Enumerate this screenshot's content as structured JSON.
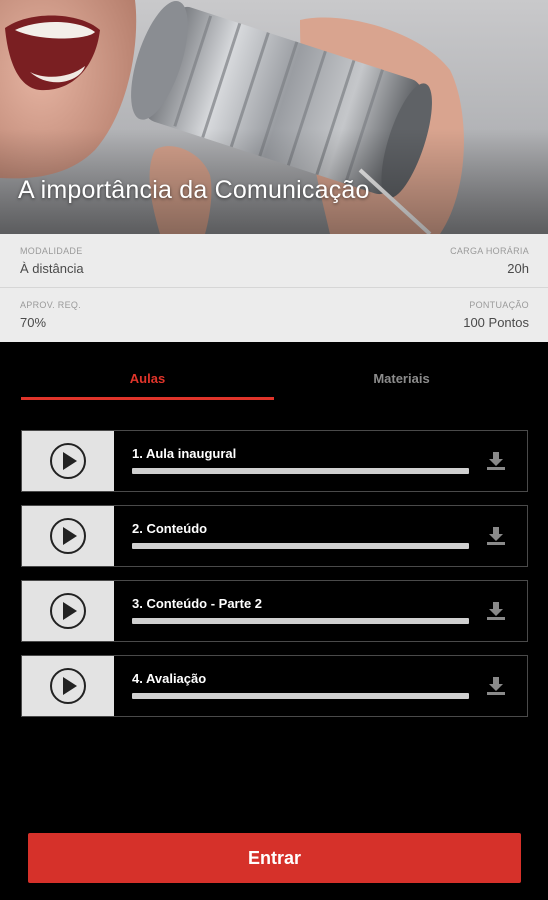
{
  "course": {
    "title": "A importância da Comunicação"
  },
  "info": {
    "modalidade_label": "MODALIDADE",
    "modalidade_value": "À distância",
    "carga_label": "CARGA HORÁRIA",
    "carga_value": "20h",
    "aprov_label": "APROV. REQ.",
    "aprov_value": "70%",
    "pontuacao_label": "PONTUAÇÃO",
    "pontuacao_value": "100 Pontos"
  },
  "tabs": [
    {
      "label": "Aulas",
      "active": true
    },
    {
      "label": "Materiais",
      "active": false
    }
  ],
  "lessons": [
    {
      "title": "1. Aula inaugural",
      "icon": "play-icon",
      "download_icon": "download-icon"
    },
    {
      "title": "2. Conteúdo",
      "icon": "play-icon",
      "download_icon": "download-icon"
    },
    {
      "title": "3. Conteúdo - Parte 2",
      "icon": "play-icon",
      "download_icon": "download-icon"
    },
    {
      "title": "4. Avaliação",
      "icon": "play-icon",
      "download_icon": "download-icon"
    }
  ],
  "actions": {
    "enter_label": "Entrar"
  },
  "colors": {
    "accent": "#d6312a",
    "tab_active": "#e0342a",
    "background": "#000000",
    "info_panel": "#ececec"
  }
}
